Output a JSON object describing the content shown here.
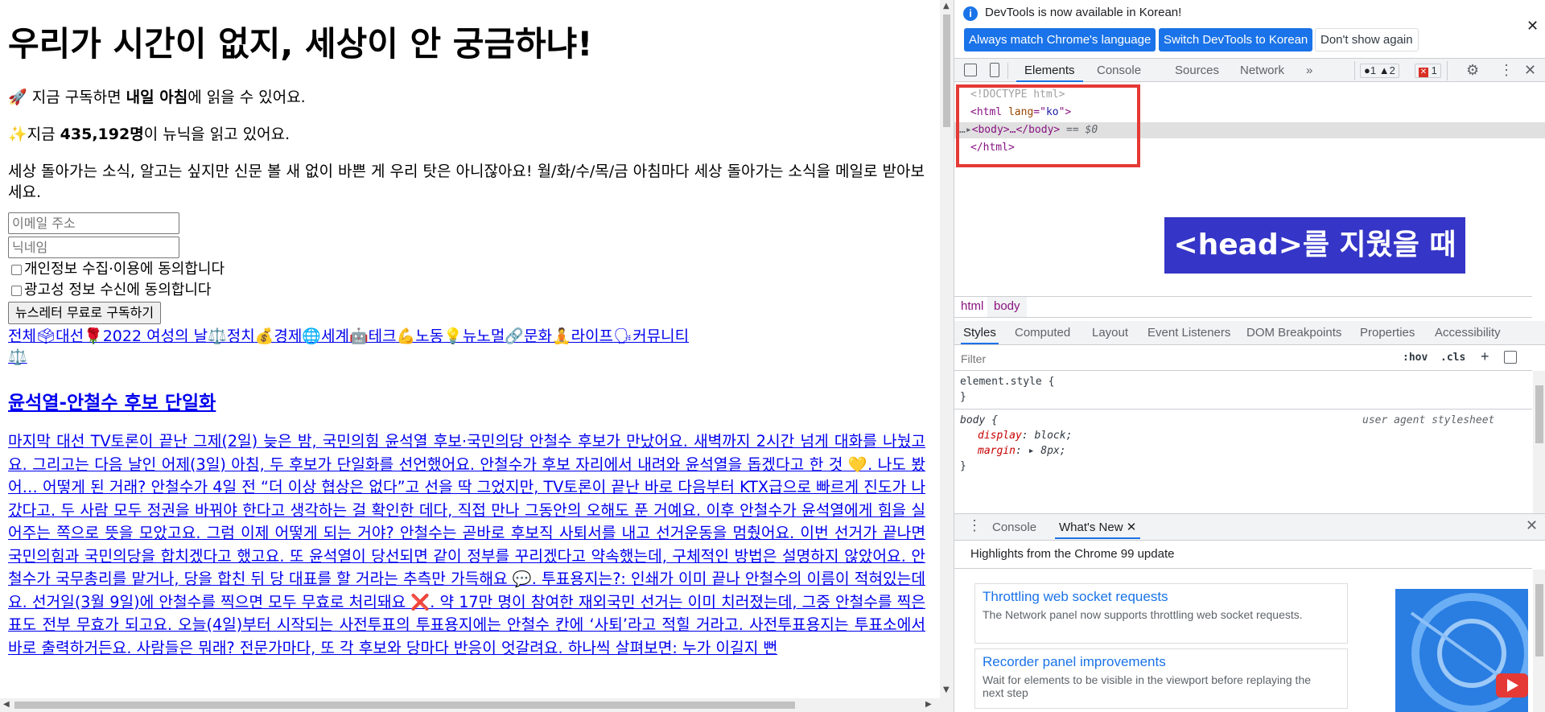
{
  "page": {
    "headline": "우리가 시간이 없지, 세상이 안 궁금하냐!",
    "line1_prefix": "🚀 지금 구독하면 ",
    "line1_bold": "내일 아침",
    "line1_suffix": "에 읽을 수 있어요.",
    "line2_prefix": "✨지금 ",
    "line2_bold": "435,192명",
    "line2_suffix": "이 뉴닉을 읽고 있어요.",
    "description": "세상 돌아가는 소식, 알고는 싶지만 신문 볼 새 없이 바쁜 게 우리 탓은 아니잖아요! 월/화/수/목/금 아침마다 세상 돌아가는 소식을 메일로 받아보세요.",
    "email_placeholder": "이메일 주소",
    "nickname_placeholder": "닉네임",
    "consent_privacy": "개인정보 수집·이용에 동의합니다",
    "consent_ads": "광고성 정보 수신에 동의합니다",
    "subscribe_button": "뉴스레터 무료로 구독하기",
    "nav": [
      "전체",
      "🗳대선",
      "🌹2022 여성의 날",
      "⚖️정치",
      "💰경제",
      "🌐세계",
      "🤖테크",
      "💪노동",
      "💡뉴노멀",
      "🔗문화",
      "🧘라이프",
      "🗣커뮤니티"
    ],
    "nav_second_line": "⚖️",
    "article_title": "윤석열-안철수 후보 단일화",
    "article_body": "마지막 대선 TV토론이 끝난 그제(2일) 늦은 밤, 국민의힘 윤석열 후보·국민의당 안철수 후보가 만났어요. 새벽까지 2시간 넘게 대화를 나눴고요. 그리고는 다음 날인 어제(3일) 아침, 두 후보가 단일화를 선언했어요. 안철수가 후보 자리에서 내려와 윤석열을 돕겠다고 한 것 💛. 나도 봤어… 어떻게 된 거래? 안철수가 4일 전 “더 이상 협상은 없다”고 선을 딱 그었지만, TV토론이 끝난 바로 다음부터 KTX급으로 빠르게 진도가 나갔다고. 두 사람 모두 정권을 바꿔야 한다고 생각하는 걸 확인한 데다, 직접 만나 그동안의 오해도 푼 거예요. 이후 안철수가 윤석열에게 힘을 실어주는 쪽으로 뜻을 모았고요. 그럼 이제 어떻게 되는 거야? 안철수는 곧바로 후보직 사퇴서를 내고 선거운동을 멈췄어요. 이번 선거가 끝나면 국민의힘과 국민의당을 합치겠다고 했고요. 또 윤석열이 당선되면 같이 정부를 꾸리겠다고 약속했는데, 구체적인 방법은 설명하지 않았어요. 안철수가 국무총리를 맡거나, 당을 합친 뒤 당 대표를 할 거라는 추측만 가득해요 💬. 투표용지는?: 인쇄가 이미 끝나 안철수의 이름이 적혀있는데요. 선거일(3월 9일)에 안철수를 찍으면 모두 무효로 처리돼요 ❌. 약 17만 명이 참여한 재외국민 선거는 이미 치러졌는데, 그중 안철수를 찍은 표도 전부 무효가 되고요. 오늘(4일)부터 시작되는 사전투표의 투표용지에는 안철수 칸에 ‘사퇴’라고 적힐 거라고. 사전투표용지는 투표소에서 바로 출력하거든요. 사람들은 뭐래? 전문가마다, 또 각 후보와 당마다 반응이 엇갈려요. 하나씩 살펴보면: 누가 이길지 뻔"
  },
  "devtools": {
    "info_message": "DevTools is now available in Korean!",
    "btn_match": "Always match Chrome's language",
    "btn_switch": "Switch DevTools to Korean",
    "btn_dismiss": "Don't show again",
    "tabs": [
      "Elements",
      "Console",
      "Sources",
      "Network"
    ],
    "more_tabs": "»",
    "error_count": "1",
    "warning_count": "2",
    "issue_count": "1",
    "dom": {
      "doctype": "<!DOCTYPE html>",
      "html_open_tag": "<html ",
      "html_attr_name": "lang",
      "html_attr_eq": "=\"",
      "html_attr_value": "ko",
      "html_attr_end": "\">",
      "body_line": "<body>…</body>",
      "selected_marker": " == $0",
      "html_close": "</html>"
    },
    "annotation": "<head>를 지웠을 때",
    "breadcrumbs": [
      "html",
      "body"
    ],
    "style_tabs": [
      "Styles",
      "Computed",
      "Layout",
      "Event Listeners",
      "DOM Breakpoints",
      "Properties",
      "Accessibility"
    ],
    "filter_placeholder": "Filter",
    "hov": ":hov",
    "cls": ".cls",
    "plus": "+",
    "rules": {
      "element_style": "element.style {",
      "close_brace": "}",
      "body_selector": "body {",
      "source": "user agent stylesheet",
      "prop1_name": "display",
      "prop1_value": "block;",
      "prop2_name": "margin",
      "prop2_value": "8px;"
    },
    "drawer_tabs": [
      "Console",
      "What's New"
    ],
    "whats_new_heading": "Highlights from the Chrome 99 update",
    "cards": [
      {
        "title": "Throttling web socket requests",
        "desc": "The Network panel now supports throttling web socket requests."
      },
      {
        "title": "Recorder panel improvements",
        "desc": "Wait for elements to be visible in the viewport before replaying the next step"
      }
    ]
  },
  "colors": {
    "link": "#0000ee",
    "accent": "#1a73e8",
    "annotation_bg": "#3535c8",
    "highlight_border": "#e53935"
  }
}
